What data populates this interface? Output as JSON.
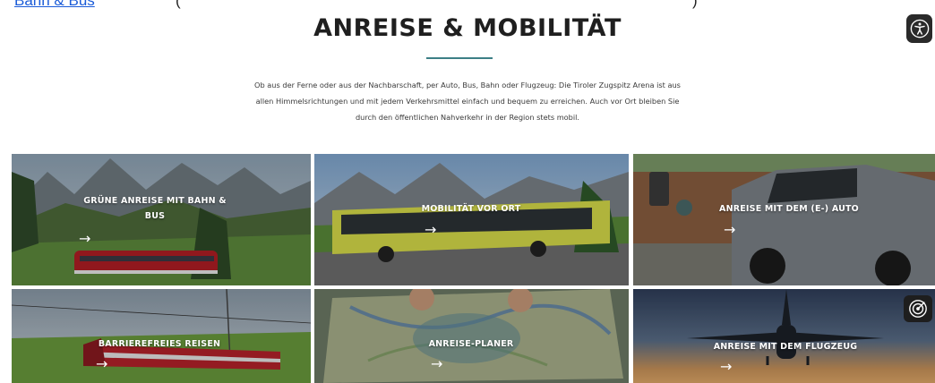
{
  "top_partial": {
    "link_text": "Bahn & Bus",
    "paren_open": "(",
    "paren_close": ")"
  },
  "section": {
    "title": "ANREISE & MOBILITÄT",
    "intro": "Ob aus der Ferne oder aus der Nachbarschaft, per Auto, Bus, Bahn oder Flugzeug: Die Tiroler Zugspitz Arena ist aus allen Himmelsrichtungen und mit jedem Verkehrsmittel einfach und bequem zu erreichen. Auch vor Ort bleiben Sie durch den öffentlichen Nahverkehr in der Region stets mobil."
  },
  "tiles": [
    {
      "label": "GRÜNE ANREISE MIT BAHN & BUS",
      "arrow": "→"
    },
    {
      "label": "MOBILITÄT VOR ORT",
      "arrow": "→"
    },
    {
      "label": "ANREISE MIT DEM (E-) AUTO",
      "arrow": "→"
    },
    {
      "label": "BARRIEREFREIES REISEN",
      "arrow": "→"
    },
    {
      "label": "ANREISE-PLANER",
      "arrow": "→"
    },
    {
      "label": "ANREISE MIT DEM FLUGZEUG",
      "arrow": "→"
    }
  ],
  "icons": {
    "accessibility": "accessibility-icon",
    "radar": "radar-icon"
  },
  "colors": {
    "accent": "#3d7f86",
    "link": "#1a5bd8"
  }
}
